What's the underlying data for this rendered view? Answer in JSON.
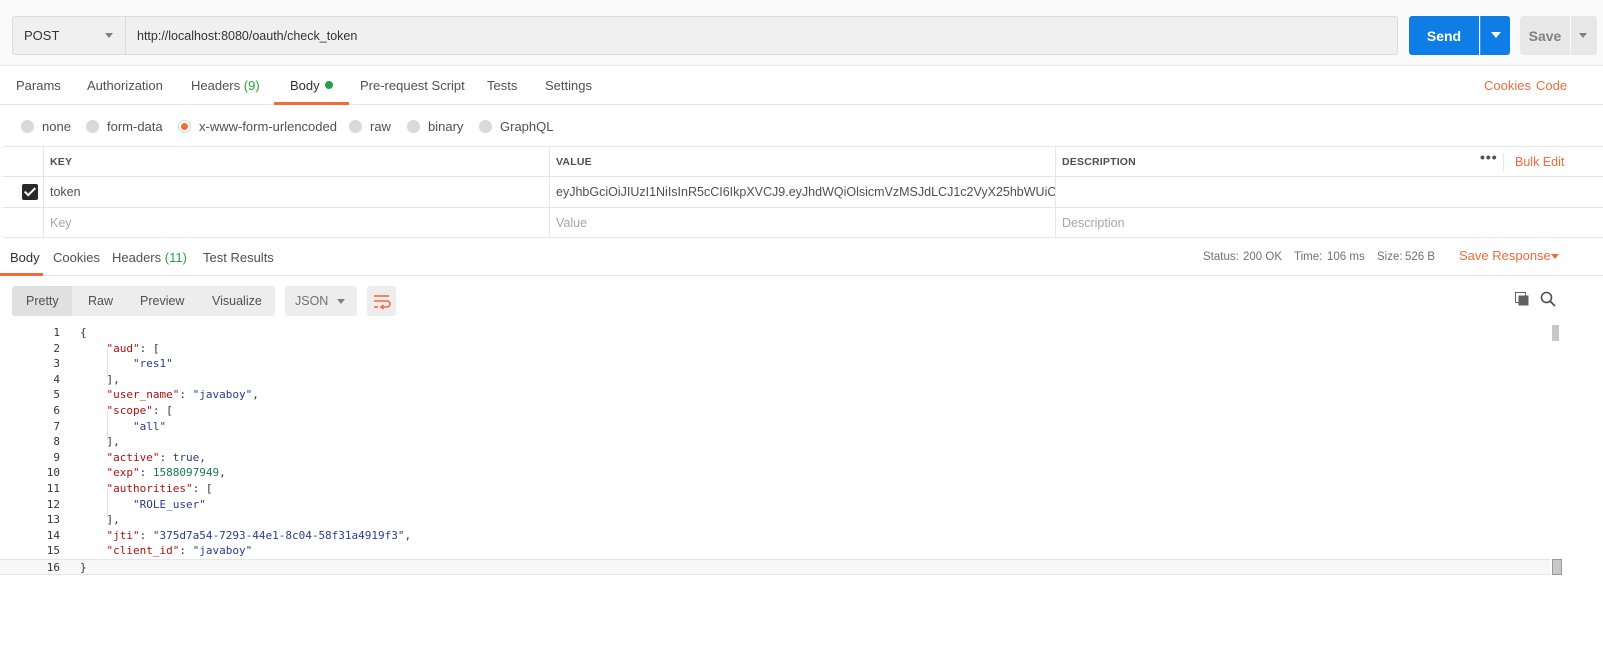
{
  "request": {
    "method": "POST",
    "url": "http://localhost:8080/oauth/check_token",
    "send_label": "Send",
    "save_label": "Save"
  },
  "request_tabs": {
    "params": "Params",
    "authorization": "Authorization",
    "headers": "Headers",
    "headers_count": "(9)",
    "body": "Body",
    "prerequest": "Pre-request Script",
    "tests": "Tests",
    "settings": "Settings",
    "cookies": "Cookies",
    "code": "Code"
  },
  "body_types": {
    "none": "none",
    "form_data": "form-data",
    "urlencoded": "x-www-form-urlencoded",
    "raw": "raw",
    "binary": "binary",
    "graphql": "GraphQL",
    "selected": "x-www-form-urlencoded"
  },
  "params_table": {
    "headers": {
      "key": "KEY",
      "value": "VALUE",
      "description": "DESCRIPTION"
    },
    "bulk_edit": "Bulk Edit",
    "more": "•••",
    "rows": [
      {
        "key": "token",
        "value": "eyJhbGciOiJIUzI1NiIsInR5cCI6IkpXVCJ9.eyJhdWQiOlsicmVzMSJdLCJ1c2VyX25hbWUiOiJqYX…",
        "description": ""
      }
    ],
    "placeholder": {
      "key": "Key",
      "value": "Value",
      "description": "Description"
    }
  },
  "response": {
    "tabs": {
      "body": "Body",
      "cookies": "Cookies",
      "headers": "Headers",
      "headers_count": "(11)",
      "test_results": "Test Results"
    },
    "status_label": "Status:",
    "status_value": "200 OK",
    "time_label": "Time:",
    "time_value": "106 ms",
    "size_label": "Size:",
    "size_value": "526 B",
    "save_response": "Save Response",
    "views": {
      "pretty": "Pretty",
      "raw": "Raw",
      "preview": "Preview",
      "visualize": "Visualize"
    },
    "format": "JSON"
  },
  "code_lines": [
    {
      "n": "1",
      "t": "{"
    },
    {
      "n": "2",
      "t": "    \"aud\": ["
    },
    {
      "n": "3",
      "t": "        \"res1\""
    },
    {
      "n": "4",
      "t": "    ],"
    },
    {
      "n": "5",
      "t": "    \"user_name\": \"javaboy\","
    },
    {
      "n": "6",
      "t": "    \"scope\": ["
    },
    {
      "n": "7",
      "t": "        \"all\""
    },
    {
      "n": "8",
      "t": "    ],"
    },
    {
      "n": "9",
      "t": "    \"active\": true,"
    },
    {
      "n": "10",
      "t": "    \"exp\": 1588097949,"
    },
    {
      "n": "11",
      "t": "    \"authorities\": ["
    },
    {
      "n": "12",
      "t": "        \"ROLE_user\""
    },
    {
      "n": "13",
      "t": "    ],"
    },
    {
      "n": "14",
      "t": "    \"jti\": \"375d7a54-7293-44e1-8c04-58f31a4919f3\","
    },
    {
      "n": "15",
      "t": "    \"client_id\": \"javaboy\""
    },
    {
      "n": "16",
      "t": "}"
    }
  ],
  "colors": {
    "accent": "#f26b3a",
    "send": "#0e7de6",
    "success": "#26a043"
  },
  "icons": {
    "method_caret": "chevron-down-icon",
    "send_caret": "chevron-down-icon",
    "wrap": "wrap-lines-icon",
    "copy": "copy-icon",
    "search": "search-icon"
  }
}
